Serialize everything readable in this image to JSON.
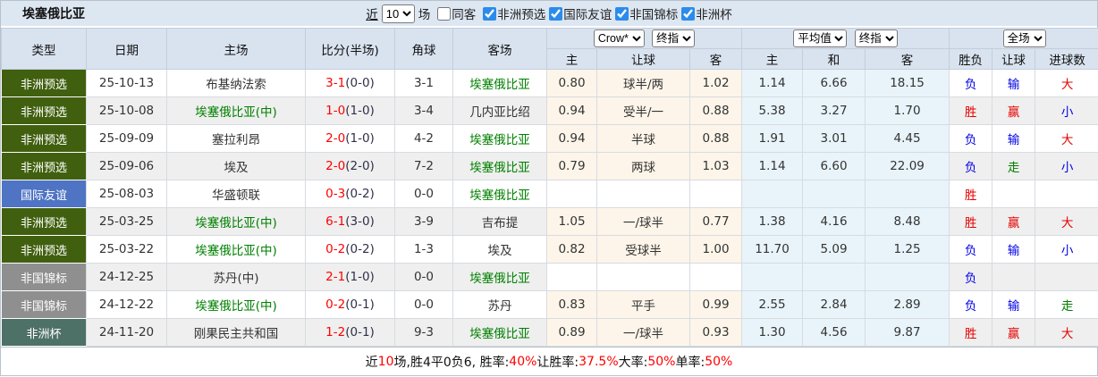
{
  "title_bar": {
    "title": "埃塞俄比亚",
    "recent_label": "近",
    "matches_count": "10",
    "matches_unit": "场",
    "same_venue_label": "同客",
    "filters": [
      {
        "label": "非洲预选",
        "checked": true
      },
      {
        "label": "国际友谊",
        "checked": true
      },
      {
        "label": "非国锦标",
        "checked": true
      },
      {
        "label": "非洲杯",
        "checked": true
      }
    ]
  },
  "table": {
    "headers": {
      "type": "类型",
      "date": "日期",
      "home": "主场",
      "score": "比分(半场)",
      "corner": "角球",
      "away": "客场",
      "odds_home": "主",
      "odds_handicap": "让球",
      "odds_away": "客",
      "avg_home": "主",
      "avg_draw": "和",
      "avg_away": "客",
      "result": "胜负",
      "handicap_result": "让球",
      "goals": "进球数"
    },
    "dropdowns": {
      "bookmaker": "Crow*",
      "bookmaker_stage": "终指",
      "average": "平均值",
      "average_stage": "终指",
      "period": "全场"
    },
    "rows": [
      {
        "type": "非洲预选",
        "date": "25-10-13",
        "home": "布基纳法索",
        "home_team": false,
        "score": "3-1",
        "half": "(0-0)",
        "corner": "3-1",
        "away": "埃塞俄比亚",
        "away_team": true,
        "odds": [
          "0.80",
          "球半/两",
          "1.02"
        ],
        "avg": [
          "1.14",
          "6.66",
          "18.15"
        ],
        "result": {
          "text": "负",
          "color": "blue"
        },
        "hcp": {
          "text": "输",
          "color": "blue"
        },
        "goals": {
          "text": "大",
          "color": "red"
        }
      },
      {
        "type": "非洲预选",
        "date": "25-10-08",
        "home": "埃塞俄比亚(中)",
        "home_team": true,
        "score": "1-0",
        "half": "(1-0)",
        "corner": "3-4",
        "away": "几内亚比绍",
        "away_team": false,
        "odds": [
          "0.94",
          "受半/一",
          "0.88"
        ],
        "avg": [
          "5.38",
          "3.27",
          "1.70"
        ],
        "result": {
          "text": "胜",
          "color": "red"
        },
        "hcp": {
          "text": "赢",
          "color": "red"
        },
        "goals": {
          "text": "小",
          "color": "blue"
        }
      },
      {
        "type": "非洲预选",
        "date": "25-09-09",
        "home": "塞拉利昂",
        "home_team": false,
        "score": "2-0",
        "half": "(1-0)",
        "corner": "4-2",
        "away": "埃塞俄比亚",
        "away_team": true,
        "odds": [
          "0.94",
          "半球",
          "0.88"
        ],
        "avg": [
          "1.91",
          "3.01",
          "4.45"
        ],
        "result": {
          "text": "负",
          "color": "blue"
        },
        "hcp": {
          "text": "输",
          "color": "blue"
        },
        "goals": {
          "text": "大",
          "color": "red"
        }
      },
      {
        "type": "非洲预选",
        "date": "25-09-06",
        "home": "埃及",
        "home_team": false,
        "score": "2-0",
        "half": "(2-0)",
        "corner": "7-2",
        "away": "埃塞俄比亚",
        "away_team": true,
        "odds": [
          "0.79",
          "两球",
          "1.03"
        ],
        "avg": [
          "1.14",
          "6.60",
          "22.09"
        ],
        "result": {
          "text": "负",
          "color": "blue"
        },
        "hcp": {
          "text": "走",
          "color": "green"
        },
        "goals": {
          "text": "小",
          "color": "blue"
        }
      },
      {
        "type": "国际友谊",
        "date": "25-08-03",
        "home": "华盛顿联",
        "home_team": false,
        "score": "0-3",
        "half": "(0-2)",
        "corner": "0-0",
        "away": "埃塞俄比亚",
        "away_team": true,
        "odds": [
          "",
          "",
          ""
        ],
        "avg": [
          "",
          "",
          ""
        ],
        "result": {
          "text": "胜",
          "color": "red"
        },
        "hcp": {
          "text": "",
          "color": ""
        },
        "goals": {
          "text": "",
          "color": ""
        }
      },
      {
        "type": "非洲预选",
        "date": "25-03-25",
        "home": "埃塞俄比亚(中)",
        "home_team": true,
        "score": "6-1",
        "half": "(3-0)",
        "corner": "3-9",
        "away": "吉布提",
        "away_team": false,
        "odds": [
          "1.05",
          "一/球半",
          "0.77"
        ],
        "avg": [
          "1.38",
          "4.16",
          "8.48"
        ],
        "result": {
          "text": "胜",
          "color": "red"
        },
        "hcp": {
          "text": "赢",
          "color": "red"
        },
        "goals": {
          "text": "大",
          "color": "red"
        }
      },
      {
        "type": "非洲预选",
        "date": "25-03-22",
        "home": "埃塞俄比亚(中)",
        "home_team": true,
        "score": "0-2",
        "half": "(0-2)",
        "corner": "1-3",
        "away": "埃及",
        "away_team": false,
        "odds": [
          "0.82",
          "受球半",
          "1.00"
        ],
        "avg": [
          "11.70",
          "5.09",
          "1.25"
        ],
        "result": {
          "text": "负",
          "color": "blue"
        },
        "hcp": {
          "text": "输",
          "color": "blue"
        },
        "goals": {
          "text": "小",
          "color": "blue"
        }
      },
      {
        "type": "非国锦标",
        "date": "24-12-25",
        "home": "苏丹(中)",
        "home_team": false,
        "score": "2-1",
        "half": "(1-0)",
        "corner": "0-0",
        "away": "埃塞俄比亚",
        "away_team": true,
        "odds": [
          "",
          "",
          ""
        ],
        "avg": [
          "",
          "",
          ""
        ],
        "result": {
          "text": "负",
          "color": "blue"
        },
        "hcp": {
          "text": "",
          "color": ""
        },
        "goals": {
          "text": "",
          "color": ""
        }
      },
      {
        "type": "非国锦标",
        "date": "24-12-22",
        "home": "埃塞俄比亚(中)",
        "home_team": true,
        "score": "0-2",
        "half": "(0-1)",
        "corner": "0-0",
        "away": "苏丹",
        "away_team": false,
        "odds": [
          "0.83",
          "平手",
          "0.99"
        ],
        "avg": [
          "2.55",
          "2.84",
          "2.89"
        ],
        "result": {
          "text": "负",
          "color": "blue"
        },
        "hcp": {
          "text": "输",
          "color": "blue"
        },
        "goals": {
          "text": "走",
          "color": "green"
        }
      },
      {
        "type": "非洲杯",
        "date": "24-11-20",
        "home": "刚果民主共和国",
        "home_team": false,
        "score": "1-2",
        "half": "(0-1)",
        "corner": "9-3",
        "away": "埃塞俄比亚",
        "away_team": true,
        "odds": [
          "0.89",
          "一/球半",
          "0.93"
        ],
        "avg": [
          "1.30",
          "4.56",
          "9.87"
        ],
        "result": {
          "text": "胜",
          "color": "red"
        },
        "hcp": {
          "text": "赢",
          "color": "red"
        },
        "goals": {
          "text": "大",
          "color": "red"
        }
      }
    ]
  },
  "footer": {
    "segments": [
      {
        "text": "近",
        "red": false
      },
      {
        "text": "10",
        "red": true
      },
      {
        "text": "场,胜4平0负6, 胜率:",
        "red": false
      },
      {
        "text": "40%",
        "red": true
      },
      {
        "text": " 让胜率:",
        "red": false
      },
      {
        "text": "37.5%",
        "red": true
      },
      {
        "text": " 大率:",
        "red": false
      },
      {
        "text": "50%",
        "red": true
      },
      {
        "text": " 单率:",
        "red": false
      },
      {
        "text": "50%",
        "red": true
      }
    ]
  },
  "colors": {
    "type_badges": {
      "非洲预选": "#41600f",
      "国际友谊": "#4f74c4",
      "非国锦标": "#8f8f8f",
      "非洲杯": "#4d7067"
    },
    "team_green": "#008000",
    "score_red": "#ff0000",
    "result_red": "#e60000",
    "result_blue": "#0000e6",
    "result_green": "#008000",
    "header_bg": "#d9e3f0",
    "odds_bg": "#fdf5e9",
    "avg_bg": "#e8f4fa"
  }
}
